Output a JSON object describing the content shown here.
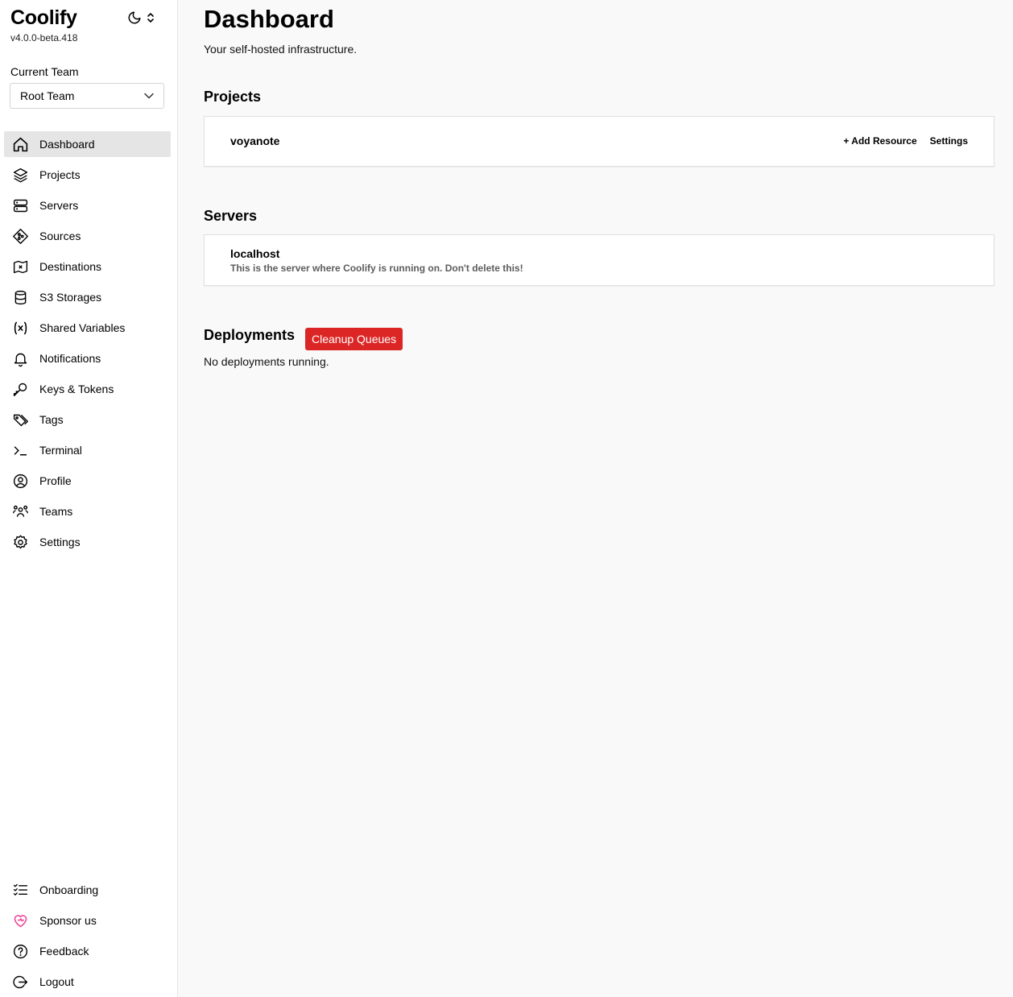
{
  "app": {
    "name": "Coolify",
    "version": "v4.0.0-beta.418"
  },
  "team": {
    "label": "Current Team",
    "selected": "Root Team"
  },
  "sidebar": {
    "items": [
      {
        "label": "Dashboard",
        "icon": "home-icon",
        "active": true
      },
      {
        "label": "Projects",
        "icon": "layers-icon"
      },
      {
        "label": "Servers",
        "icon": "server-icon"
      },
      {
        "label": "Sources",
        "icon": "git-icon"
      },
      {
        "label": "Destinations",
        "icon": "map-icon"
      },
      {
        "label": "S3 Storages",
        "icon": "database-icon"
      },
      {
        "label": "Shared Variables",
        "icon": "variable-icon"
      },
      {
        "label": "Notifications",
        "icon": "bell-icon"
      },
      {
        "label": "Keys & Tokens",
        "icon": "key-icon"
      },
      {
        "label": "Tags",
        "icon": "tags-icon"
      },
      {
        "label": "Terminal",
        "icon": "terminal-icon"
      },
      {
        "label": "Profile",
        "icon": "user-circle-icon"
      },
      {
        "label": "Teams",
        "icon": "users-icon"
      },
      {
        "label": "Settings",
        "icon": "gear-icon"
      }
    ],
    "bottom": [
      {
        "label": "Onboarding",
        "icon": "checklist-icon"
      },
      {
        "label": "Sponsor us",
        "icon": "heart-icon"
      },
      {
        "label": "Feedback",
        "icon": "help-icon"
      },
      {
        "label": "Logout",
        "icon": "logout-icon"
      }
    ]
  },
  "main": {
    "title": "Dashboard",
    "subtitle": "Your self-hosted infrastructure.",
    "projects": {
      "heading": "Projects",
      "items": [
        {
          "name": "voyanote",
          "add_label": "+ Add Resource",
          "settings_label": "Settings"
        }
      ]
    },
    "servers": {
      "heading": "Servers",
      "items": [
        {
          "name": "localhost",
          "description": "This is the server where Coolify is running on. Don't delete this!"
        }
      ]
    },
    "deployments": {
      "heading": "Deployments",
      "cleanup_label": "Cleanup Queues",
      "empty_text": "No deployments running."
    }
  },
  "colors": {
    "danger": "#dc2626",
    "active_nav": "#e5e5e5",
    "sponsor_heart": "#ec4899"
  }
}
